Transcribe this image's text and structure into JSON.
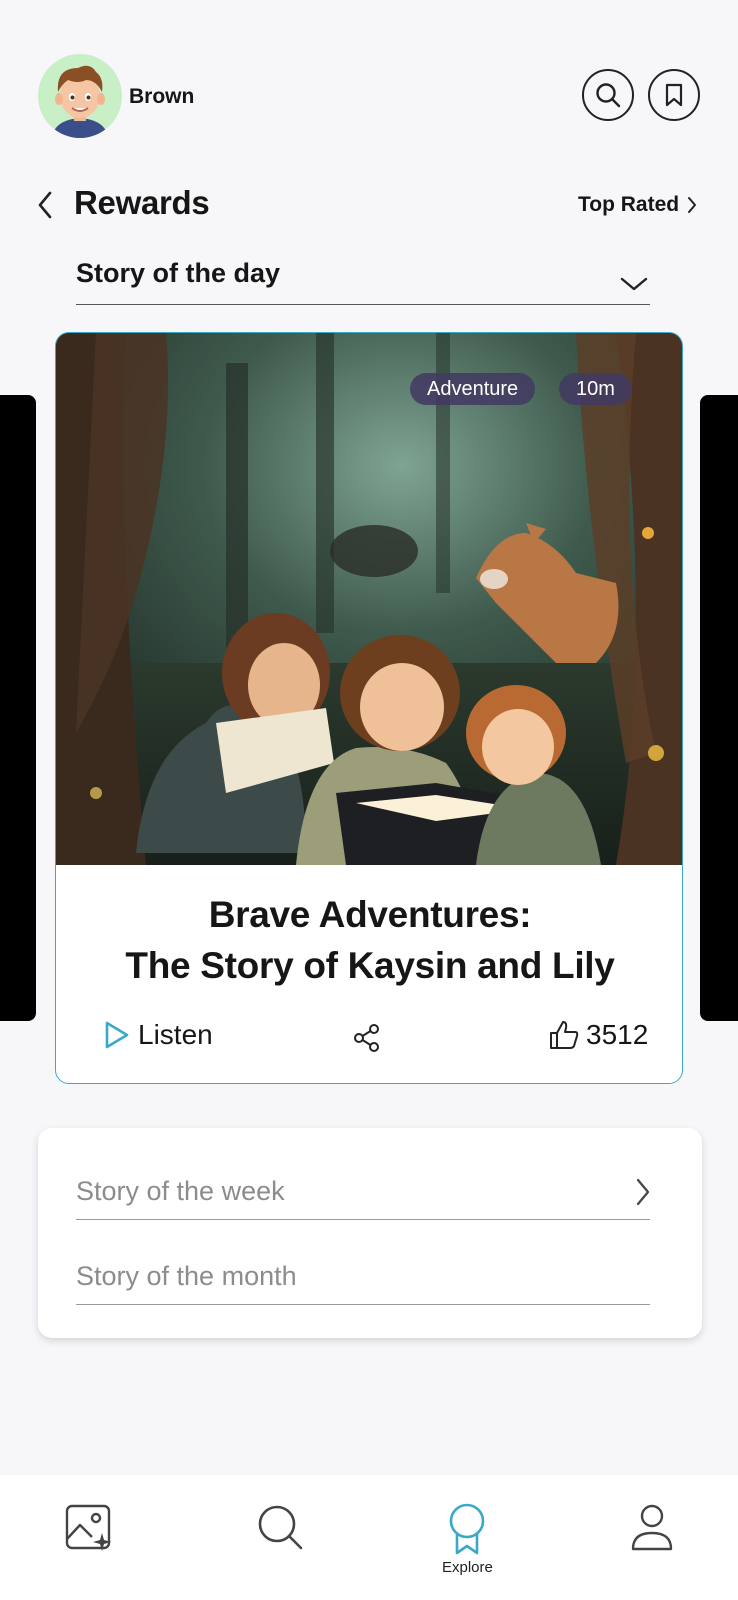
{
  "user": {
    "name": "Brown"
  },
  "header": {
    "title": "Rewards",
    "top_rated_label": "Top Rated"
  },
  "dropdown": {
    "selected": "Story of the day"
  },
  "featured_story": {
    "genre": "Adventure",
    "duration": "10m",
    "title_line1": "Brave Adventures:",
    "title_line2": "The Story of Kaysin and Lily",
    "listen_label": "Listen",
    "likes": "3512"
  },
  "other_stories": [
    {
      "label": "Story of the week"
    },
    {
      "label": "Story of the month"
    }
  ],
  "nav": {
    "items": [
      {
        "icon": "gallery-sparkle-icon",
        "label": ""
      },
      {
        "icon": "search-icon",
        "label": ""
      },
      {
        "icon": "award-icon",
        "label": "Explore",
        "active": true
      },
      {
        "icon": "profile-icon",
        "label": ""
      }
    ]
  },
  "colors": {
    "accent": "#3aa9c6",
    "tag_bg": "#423a62",
    "avatar_bg": "#c9efc6"
  }
}
